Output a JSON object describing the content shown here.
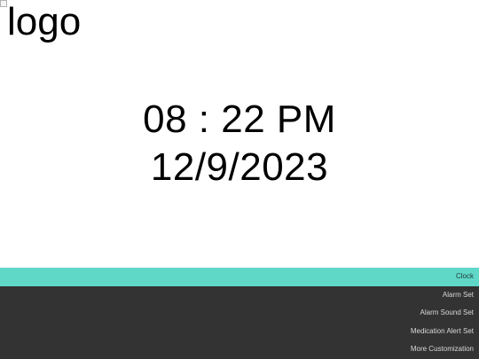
{
  "logo": {
    "alt_text": "logo"
  },
  "clock": {
    "time": "08 : 22 PM",
    "date": "12/9/2023"
  },
  "menu": {
    "items": [
      {
        "label": "Clock",
        "active": true
      },
      {
        "label": "Alarm Set",
        "active": false
      },
      {
        "label": "Alarm Sound Set",
        "active": false
      },
      {
        "label": "Medication Alert Set",
        "active": false
      },
      {
        "label": "More Customization",
        "active": false
      }
    ]
  },
  "colors": {
    "accent": "#5fd8c8",
    "menu_background": "#333333",
    "menu_text": "#d8d8d8"
  }
}
